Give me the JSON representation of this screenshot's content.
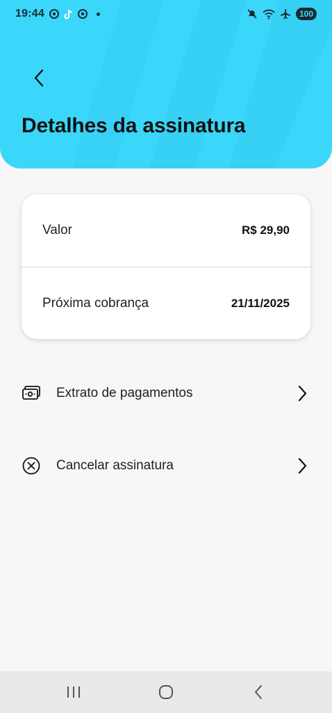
{
  "status_bar": {
    "time": "19:44",
    "battery": "100",
    "icons_left": [
      "chrome-icon",
      "tiktok-icon",
      "chrome-icon",
      "notification-dot"
    ],
    "icons_right": [
      "mute-icon",
      "wifi-icon",
      "airplane-mode-icon",
      "battery-icon"
    ]
  },
  "header": {
    "title": "Detalhes da assinatura",
    "background_color": "#3ad7fb"
  },
  "summary": {
    "rows": [
      {
        "label": "Valor",
        "value": "R$ 29,90"
      },
      {
        "label": "Próxima cobrança",
        "value": "21/11/2025"
      }
    ]
  },
  "actions": [
    {
      "label": "Extrato de pagamentos",
      "icon": "payment-statement-icon"
    },
    {
      "label": "Cancelar assinatura",
      "icon": "cancel-circle-icon"
    }
  ],
  "nav_bar": {
    "buttons": [
      "recent-apps-icon",
      "home-icon",
      "back-icon"
    ]
  }
}
